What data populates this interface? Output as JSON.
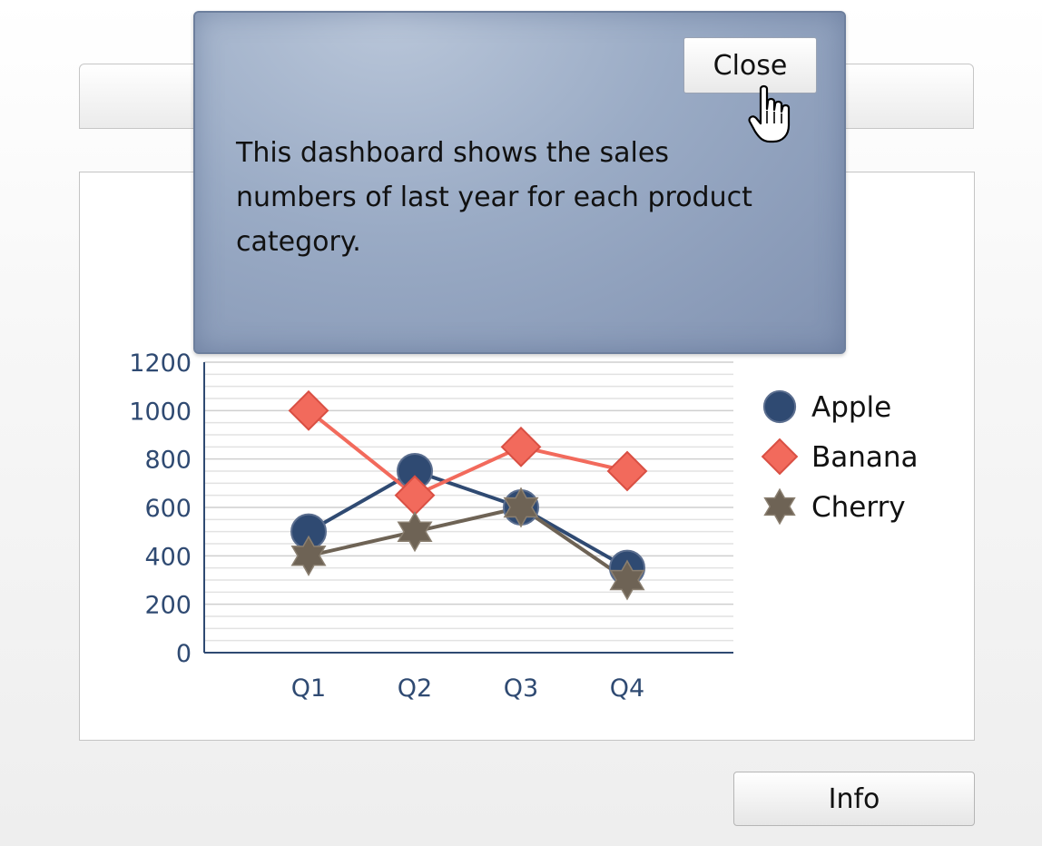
{
  "popup": {
    "close_label": "Close",
    "message": "This dashboard shows the sales numbers of last year for each product category."
  },
  "footer": {
    "info_label": "Info"
  },
  "chart_data": {
    "type": "line",
    "categories": [
      "Q1",
      "Q2",
      "Q3",
      "Q4"
    ],
    "series": [
      {
        "name": "Apple",
        "values": [
          500,
          750,
          600,
          350
        ],
        "color": "#2f4a72",
        "marker": "circle"
      },
      {
        "name": "Banana",
        "values": [
          1000,
          650,
          850,
          750
        ],
        "color": "#f26a5c",
        "marker": "diamond"
      },
      {
        "name": "Cherry",
        "values": [
          400,
          500,
          600,
          300
        ],
        "color": "#6e6355",
        "marker": "star"
      }
    ],
    "y_ticks": [
      "0",
      "200",
      "400",
      "600",
      "800",
      "1000",
      "1200"
    ],
    "ylim": [
      0,
      1200
    ],
    "grid": true,
    "legend_position": "right",
    "axis_color": "#2f4a72",
    "title": "",
    "xlabel": "",
    "ylabel": ""
  }
}
